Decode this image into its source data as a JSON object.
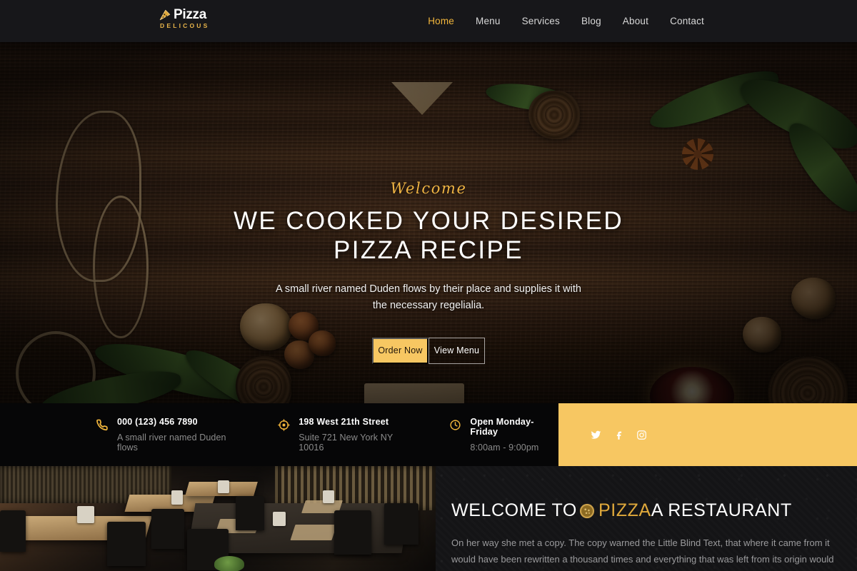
{
  "nav": {
    "brand": {
      "name": "Pizza",
      "sub": "DELICOUS",
      "icon": "pizza-slice-icon"
    },
    "links": [
      {
        "label": "Home",
        "active": true
      },
      {
        "label": "Menu",
        "active": false
      },
      {
        "label": "Services",
        "active": false
      },
      {
        "label": "Blog",
        "active": false
      },
      {
        "label": "About",
        "active": false
      },
      {
        "label": "Contact",
        "active": false
      }
    ]
  },
  "hero": {
    "eyebrow": "Welcome",
    "title_line1": "WE COOKED YOUR DESIRED",
    "title_line2": "PIZZA RECIPE",
    "subtitle": "A small river named Duden flows by their place and supplies it with the necessary regelialia.",
    "primary_button": "Order Now",
    "secondary_button": "View Menu",
    "slider_dots": 3,
    "slider_active_index": 2
  },
  "infobar": {
    "items": [
      {
        "icon": "phone-icon",
        "title": "000 (123) 456 7890",
        "desc": "A small river named Duden flows"
      },
      {
        "icon": "location-target-icon",
        "title": "198 West 21th Street",
        "desc": "Suite 721 New York NY 10016"
      },
      {
        "icon": "clock-icon",
        "title": "Open Monday-Friday",
        "desc": "8:00am - 9:00pm"
      }
    ],
    "social": [
      {
        "icon": "twitter-icon",
        "label": "Twitter"
      },
      {
        "icon": "facebook-icon",
        "label": "Facebook"
      },
      {
        "icon": "instagram-icon",
        "label": "Instagram"
      }
    ]
  },
  "welcome_section": {
    "title_before": "WELCOME TO ",
    "title_highlight": "PIZZA",
    "title_after": " A RESTAURANT",
    "icon": "pizza-round-icon",
    "body": "On her way she met a copy. The copy warned the Little Blind Text, that where it came from it would have been rewritten a thousand times and everything that was left from its origin would"
  },
  "colors": {
    "accent_gold": "#f7c762",
    "accent_gold_text": "#f2b63c",
    "nav_bg": "#17171a",
    "info_bg": "#060607",
    "panel_bg": "#141416",
    "muted_text": "#8b8b8b"
  }
}
